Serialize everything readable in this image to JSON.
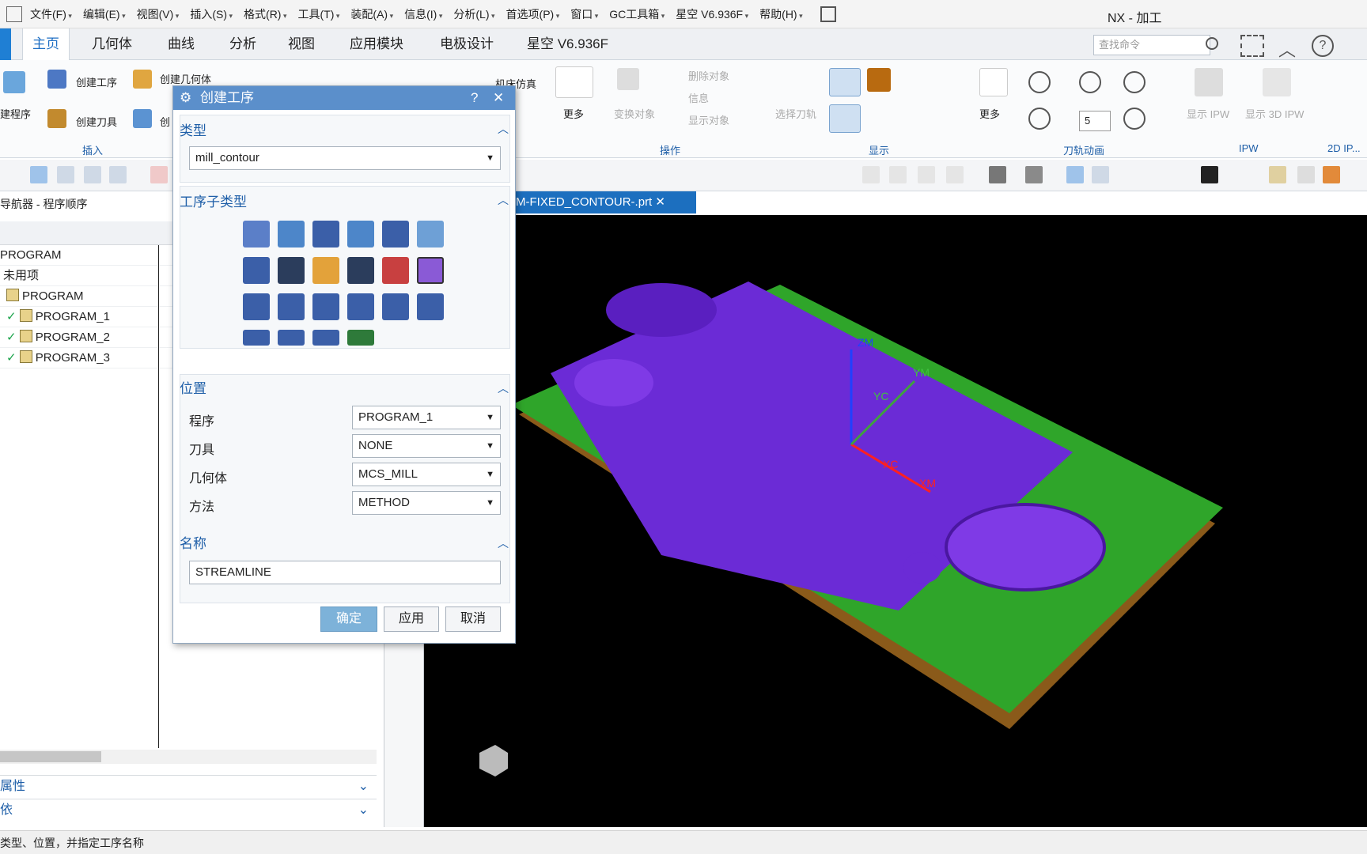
{
  "menubar": {
    "items": [
      "文件(F)",
      "编辑(E)",
      "视图(V)",
      "插入(S)",
      "格式(R)",
      "工具(T)",
      "装配(A)",
      "信息(I)",
      "分析(L)",
      "首选项(P)",
      "窗口",
      "GC工具箱",
      "星空 V6.936F",
      "帮助(H)"
    ],
    "app_title": "NX - 加工"
  },
  "tabs": [
    "主页",
    "几何体",
    "曲线",
    "分析",
    "视图",
    "应用模块",
    "电极设计",
    "星空 V6.936F"
  ],
  "search": {
    "placeholder": "查找命令"
  },
  "ribbon": {
    "create_program": "建程序",
    "create_operation": "创建工序",
    "create_geometry": "创建几何体",
    "create_tool": "创建刀具",
    "create_method": "创",
    "group_insert": "插入",
    "machine_sim": "机床仿真",
    "more": "更多",
    "transform": "变换对象",
    "delete_obj": "删除对象",
    "info": "信息",
    "show_obj": "显示对象",
    "group_ops": "操作",
    "select_toolpath": "选择刀轨",
    "more2": "更多",
    "group_display": "显示",
    "speed": "5",
    "group_anim": "刀轨动画",
    "show_ipw": "显示 IPW",
    "show_3d_ipw": "显示 3D IPW",
    "group_ipw": "IPW",
    "group_2d": "2D IP..."
  },
  "navigator": {
    "title": "导航器 - 程序顺序",
    "rows": [
      "PROGRAM",
      "未用项",
      "PROGRAM",
      "PROGRAM_1",
      "PROGRAM_2",
      "PROGRAM_3"
    ],
    "section_attr": "属性",
    "section_dep": "依"
  },
  "file_tab": "M-FIXED_CONTOUR-.prt",
  "dialog": {
    "title": "创建工序",
    "help": "?",
    "close": "✕",
    "type_section": "类型",
    "type_value": "mill_contour",
    "subtype_section": "工序子类型",
    "location_section": "位置",
    "program_label": "程序",
    "program_value": "PROGRAM_1",
    "tool_label": "刀具",
    "tool_value": "NONE",
    "geometry_label": "几何体",
    "geometry_value": "MCS_MILL",
    "method_label": "方法",
    "method_value": "METHOD",
    "name_section": "名称",
    "name_value": "STREAMLINE",
    "ok": "确定",
    "apply": "应用",
    "cancel": "取消"
  },
  "status": "类型、位置，并指定工序名称",
  "viewport_labels": {
    "zm": "ZM",
    "ym": "YM",
    "yc": "YC",
    "xc": "XC",
    "xm": "XM"
  }
}
